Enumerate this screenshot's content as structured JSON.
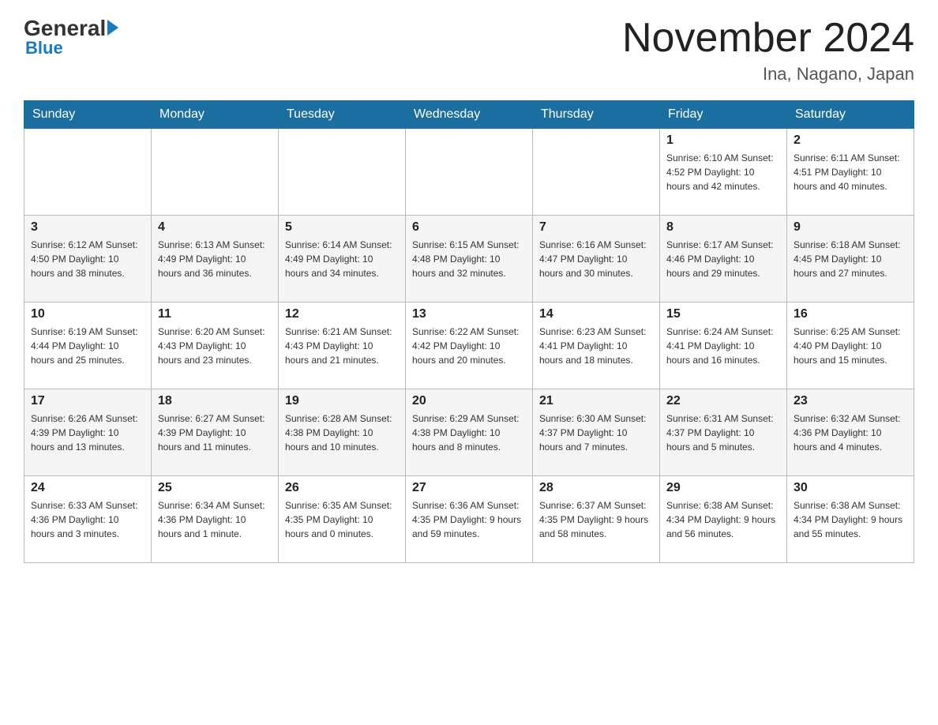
{
  "header": {
    "logo": {
      "general": "General",
      "blue": "Blue"
    },
    "title": "November 2024",
    "location": "Ina, Nagano, Japan"
  },
  "weekdays": [
    "Sunday",
    "Monday",
    "Tuesday",
    "Wednesday",
    "Thursday",
    "Friday",
    "Saturday"
  ],
  "weeks": [
    [
      {
        "day": "",
        "info": ""
      },
      {
        "day": "",
        "info": ""
      },
      {
        "day": "",
        "info": ""
      },
      {
        "day": "",
        "info": ""
      },
      {
        "day": "",
        "info": ""
      },
      {
        "day": "1",
        "info": "Sunrise: 6:10 AM\nSunset: 4:52 PM\nDaylight: 10 hours and 42 minutes."
      },
      {
        "day": "2",
        "info": "Sunrise: 6:11 AM\nSunset: 4:51 PM\nDaylight: 10 hours and 40 minutes."
      }
    ],
    [
      {
        "day": "3",
        "info": "Sunrise: 6:12 AM\nSunset: 4:50 PM\nDaylight: 10 hours and 38 minutes."
      },
      {
        "day": "4",
        "info": "Sunrise: 6:13 AM\nSunset: 4:49 PM\nDaylight: 10 hours and 36 minutes."
      },
      {
        "day": "5",
        "info": "Sunrise: 6:14 AM\nSunset: 4:49 PM\nDaylight: 10 hours and 34 minutes."
      },
      {
        "day": "6",
        "info": "Sunrise: 6:15 AM\nSunset: 4:48 PM\nDaylight: 10 hours and 32 minutes."
      },
      {
        "day": "7",
        "info": "Sunrise: 6:16 AM\nSunset: 4:47 PM\nDaylight: 10 hours and 30 minutes."
      },
      {
        "day": "8",
        "info": "Sunrise: 6:17 AM\nSunset: 4:46 PM\nDaylight: 10 hours and 29 minutes."
      },
      {
        "day": "9",
        "info": "Sunrise: 6:18 AM\nSunset: 4:45 PM\nDaylight: 10 hours and 27 minutes."
      }
    ],
    [
      {
        "day": "10",
        "info": "Sunrise: 6:19 AM\nSunset: 4:44 PM\nDaylight: 10 hours and 25 minutes."
      },
      {
        "day": "11",
        "info": "Sunrise: 6:20 AM\nSunset: 4:43 PM\nDaylight: 10 hours and 23 minutes."
      },
      {
        "day": "12",
        "info": "Sunrise: 6:21 AM\nSunset: 4:43 PM\nDaylight: 10 hours and 21 minutes."
      },
      {
        "day": "13",
        "info": "Sunrise: 6:22 AM\nSunset: 4:42 PM\nDaylight: 10 hours and 20 minutes."
      },
      {
        "day": "14",
        "info": "Sunrise: 6:23 AM\nSunset: 4:41 PM\nDaylight: 10 hours and 18 minutes."
      },
      {
        "day": "15",
        "info": "Sunrise: 6:24 AM\nSunset: 4:41 PM\nDaylight: 10 hours and 16 minutes."
      },
      {
        "day": "16",
        "info": "Sunrise: 6:25 AM\nSunset: 4:40 PM\nDaylight: 10 hours and 15 minutes."
      }
    ],
    [
      {
        "day": "17",
        "info": "Sunrise: 6:26 AM\nSunset: 4:39 PM\nDaylight: 10 hours and 13 minutes."
      },
      {
        "day": "18",
        "info": "Sunrise: 6:27 AM\nSunset: 4:39 PM\nDaylight: 10 hours and 11 minutes."
      },
      {
        "day": "19",
        "info": "Sunrise: 6:28 AM\nSunset: 4:38 PM\nDaylight: 10 hours and 10 minutes."
      },
      {
        "day": "20",
        "info": "Sunrise: 6:29 AM\nSunset: 4:38 PM\nDaylight: 10 hours and 8 minutes."
      },
      {
        "day": "21",
        "info": "Sunrise: 6:30 AM\nSunset: 4:37 PM\nDaylight: 10 hours and 7 minutes."
      },
      {
        "day": "22",
        "info": "Sunrise: 6:31 AM\nSunset: 4:37 PM\nDaylight: 10 hours and 5 minutes."
      },
      {
        "day": "23",
        "info": "Sunrise: 6:32 AM\nSunset: 4:36 PM\nDaylight: 10 hours and 4 minutes."
      }
    ],
    [
      {
        "day": "24",
        "info": "Sunrise: 6:33 AM\nSunset: 4:36 PM\nDaylight: 10 hours and 3 minutes."
      },
      {
        "day": "25",
        "info": "Sunrise: 6:34 AM\nSunset: 4:36 PM\nDaylight: 10 hours and 1 minute."
      },
      {
        "day": "26",
        "info": "Sunrise: 6:35 AM\nSunset: 4:35 PM\nDaylight: 10 hours and 0 minutes."
      },
      {
        "day": "27",
        "info": "Sunrise: 6:36 AM\nSunset: 4:35 PM\nDaylight: 9 hours and 59 minutes."
      },
      {
        "day": "28",
        "info": "Sunrise: 6:37 AM\nSunset: 4:35 PM\nDaylight: 9 hours and 58 minutes."
      },
      {
        "day": "29",
        "info": "Sunrise: 6:38 AM\nSunset: 4:34 PM\nDaylight: 9 hours and 56 minutes."
      },
      {
        "day": "30",
        "info": "Sunrise: 6:38 AM\nSunset: 4:34 PM\nDaylight: 9 hours and 55 minutes."
      }
    ]
  ]
}
